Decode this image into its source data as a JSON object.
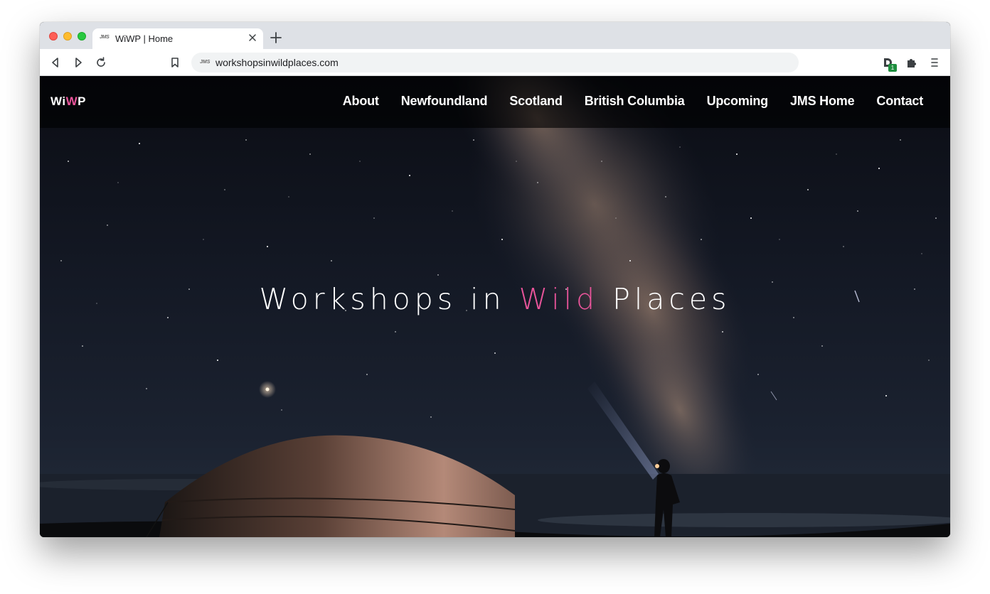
{
  "browser": {
    "tab": {
      "favicon_text": "JMS",
      "title": "WiWP | Home"
    },
    "omnibox": {
      "favicon_text": "JMS",
      "url": "workshopsinwildplaces.com"
    },
    "extension_badge": "1"
  },
  "site": {
    "logo": {
      "part1": "Wi",
      "part2": "W",
      "part3": "P"
    },
    "nav": [
      {
        "label": "About"
      },
      {
        "label": "Newfoundland"
      },
      {
        "label": "Scotland"
      },
      {
        "label": "British Columbia"
      },
      {
        "label": "Upcoming"
      },
      {
        "label": "JMS Home"
      },
      {
        "label": "Contact"
      }
    ],
    "hero": {
      "title_part1": "Workshops in ",
      "title_accent": "Wild",
      "title_part2": " Places"
    },
    "colors": {
      "accent": "#e8549a",
      "nav_background": "rgba(0,0,0,0.62)"
    }
  }
}
